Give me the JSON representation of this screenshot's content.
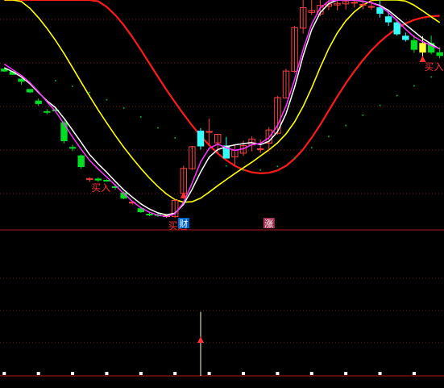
{
  "chart_data": {
    "type": "candlestick",
    "bar_count": 52,
    "colors": {
      "background": "#000000",
      "grid": "#7a1a1a",
      "up": "#33ffff",
      "down": "#00dd22",
      "up_outline": "#ff4040",
      "ma_white": "#ffffff",
      "ma_magenta": "#ff33ff",
      "ma_yellow": "#ffff00",
      "ma_red": "#ff1a1a",
      "dots": "#00aa44",
      "signal": "#ff3333",
      "highlight": "#ffff33",
      "volume_dots": "#ffffff"
    },
    "candles": [
      {
        "o": 0.33,
        "h": 0.33,
        "l": 0.22,
        "c": 0.25,
        "color": "down"
      },
      {
        "o": 0.22,
        "h": 0.25,
        "l": 0.09,
        "c": 0.12,
        "color": "down"
      },
      {
        "o": -0.15,
        "h": -0.04,
        "l": -0.27,
        "c": -0.06,
        "color": "down"
      },
      {
        "o": -0.46,
        "h": -0.47,
        "l": -0.6,
        "c": -0.56,
        "color": "down"
      },
      {
        "o": -0.91,
        "h": -0.81,
        "l": -1.1,
        "c": -1.01,
        "color": "down"
      },
      {
        "o": -1.32,
        "h": -1.22,
        "l": -1.43,
        "c": -1.33,
        "color": "down"
      },
      {
        "o": -1.27,
        "h": -1.17,
        "l": -1.32,
        "c": -1.26,
        "color": "down"
      },
      {
        "o": -1.75,
        "h": -1.67,
        "l": -2.55,
        "c": -2.45,
        "color": "down"
      },
      {
        "o": -2.71,
        "h": -2.6,
        "l": -2.85,
        "c": -2.74,
        "color": "down"
      },
      {
        "o": -3.03,
        "h": -2.98,
        "l": -3.54,
        "c": -3.45,
        "color": "down"
      },
      {
        "o": -3.91,
        "h": -3.86,
        "l": -4.04,
        "c": -3.95,
        "color": "up_outline"
      },
      {
        "o": -3.97,
        "h": -3.86,
        "l": -4.04,
        "c": -3.93,
        "color": "down"
      },
      {
        "o": -3.98,
        "h": -3.94,
        "l": -4.03,
        "c": -4.0,
        "color": "down"
      },
      {
        "o": -4.23,
        "h": -4.12,
        "l": -4.34,
        "c": -4.23,
        "color": "down"
      },
      {
        "o": -4.47,
        "h": -4.42,
        "l": -4.71,
        "c": -4.67,
        "color": "down"
      },
      {
        "o": -4.83,
        "h": -4.78,
        "l": -4.92,
        "c": -4.83,
        "color": "up_outline"
      },
      {
        "o": -5.08,
        "h": -5.02,
        "l": -5.24,
        "c": -5.2,
        "color": "down"
      },
      {
        "o": -5.29,
        "h": -5.24,
        "l": -5.37,
        "c": -5.29,
        "color": "down"
      },
      {
        "o": -5.31,
        "h": -5.26,
        "l": -5.4,
        "c": -5.32,
        "color": "down"
      },
      {
        "o": -5.35,
        "h": -5.32,
        "l": -5.43,
        "c": -5.38,
        "color": "highlight"
      },
      {
        "o": -5.38,
        "h": -4.69,
        "l": -5.43,
        "c": -4.76,
        "color": "up_outline"
      },
      {
        "o": -4.49,
        "h": -3.42,
        "l": -4.54,
        "c": -3.52,
        "color": "up_outline"
      },
      {
        "o": -3.53,
        "h": -2.65,
        "l": -3.58,
        "c": -2.68,
        "color": "up_outline"
      },
      {
        "o": -2.65,
        "h": -1.96,
        "l": -2.79,
        "c": -2.07,
        "color": "up"
      },
      {
        "o": -2.09,
        "h": -1.6,
        "l": -2.63,
        "c": -2.11,
        "color": "up_outline"
      },
      {
        "o": -2.2,
        "h": -2.18,
        "l": -2.92,
        "c": -2.53,
        "color": "up_outline"
      },
      {
        "o": -2.65,
        "h": -2.3,
        "l": -3.03,
        "c": -3.12,
        "color": "up"
      },
      {
        "o": -3.07,
        "h": -2.61,
        "l": -3.42,
        "c": -2.82,
        "color": "up_outline"
      },
      {
        "o": -2.93,
        "h": -2.45,
        "l": -3.03,
        "c": -2.64,
        "color": "up_outline"
      },
      {
        "o": -2.61,
        "h": -2.28,
        "l": -2.86,
        "c": -2.38,
        "color": "up_outline"
      },
      {
        "o": -2.76,
        "h": -2.4,
        "l": -2.92,
        "c": -2.76,
        "color": "up_outline"
      },
      {
        "o": -2.54,
        "h": -1.92,
        "l": -2.86,
        "c": -2.03,
        "color": "up_outline"
      },
      {
        "o": -2.16,
        "h": -0.71,
        "l": -2.21,
        "c": -0.78,
        "color": "up_outline"
      },
      {
        "o": -0.79,
        "h": 0.34,
        "l": -0.8,
        "c": 0.25,
        "color": "up_outline"
      },
      {
        "o": 0.24,
        "h": 2.0,
        "l": 0.18,
        "c": 1.93,
        "color": "up_outline"
      },
      {
        "o": 1.91,
        "h": 3.0,
        "l": 1.7,
        "c": 2.7,
        "color": "up_outline"
      },
      {
        "o": 2.59,
        "h": 3.4,
        "l": 2.42,
        "c": 2.52,
        "color": "up_outline"
      },
      {
        "o": 2.46,
        "h": 3.0,
        "l": 2.37,
        "c": 2.79,
        "color": "up_outline"
      },
      {
        "o": 2.76,
        "h": 3.0,
        "l": 2.61,
        "c": 2.84,
        "color": "up_outline"
      },
      {
        "o": 2.81,
        "h": 3.0,
        "l": 2.6,
        "c": 2.87,
        "color": "up_outline"
      },
      {
        "o": 2.85,
        "h": 3.0,
        "l": 2.63,
        "c": 2.94,
        "color": "up_outline"
      },
      {
        "o": 2.91,
        "h": 3.0,
        "l": 2.71,
        "c": 2.89,
        "color": "up_outline"
      },
      {
        "o": 2.83,
        "h": 3.0,
        "l": 2.64,
        "c": 2.81,
        "color": "up_outline"
      },
      {
        "o": 2.75,
        "h": 3.0,
        "l": 2.62,
        "c": 2.73,
        "color": "up_outline"
      },
      {
        "o": 2.7,
        "h": 3.0,
        "l": 2.32,
        "c": 2.48,
        "color": "up"
      },
      {
        "o": 2.35,
        "h": 2.62,
        "l": 2.0,
        "c": 2.15,
        "color": "up"
      },
      {
        "o": 2.12,
        "h": 2.23,
        "l": 1.62,
        "c": 1.69,
        "color": "up"
      },
      {
        "o": 1.6,
        "h": 1.74,
        "l": 1.39,
        "c": 1.47,
        "color": "up"
      },
      {
        "o": 1.43,
        "h": 1.64,
        "l": 0.96,
        "c": 1.09,
        "color": "down"
      },
      {
        "o": 0.98,
        "h": 1.6,
        "l": 0.71,
        "c": 1.32,
        "color": "highlight"
      },
      {
        "o": 1.32,
        "h": 1.62,
        "l": 0.9,
        "c": 0.98,
        "color": "down"
      },
      {
        "o": 0.96,
        "h": 1.18,
        "l": 0.74,
        "c": 0.85,
        "color": "down"
      }
    ],
    "ma_white": [
      0.38,
      0.22,
      0.02,
      -0.24,
      -0.58,
      -0.9,
      -1.17,
      -1.58,
      -2.04,
      -2.51,
      -2.99,
      -3.35,
      -3.67,
      -4.02,
      -4.35,
      -4.63,
      -4.89,
      -5.09,
      -5.24,
      -5.32,
      -5.25,
      -4.91,
      -4.33,
      -3.66,
      -3.08,
      -2.79,
      -2.68,
      -2.61,
      -2.56,
      -2.52,
      -2.6,
      -2.47,
      -2.1,
      -1.4,
      -0.38,
      0.84,
      1.85,
      2.51,
      2.86,
      3.0,
      3.0,
      2.99,
      2.95,
      2.89,
      2.79,
      2.6,
      2.33,
      2.05,
      1.78,
      1.51,
      1.3,
      1.1
    ],
    "ma_magenta": [
      0.52,
      0.3,
      0.08,
      -0.2,
      -0.55,
      -0.94,
      -1.31,
      -1.8,
      -2.31,
      -2.78,
      -3.21,
      -3.55,
      -3.85,
      -4.17,
      -4.49,
      -4.79,
      -5.04,
      -5.22,
      -5.33,
      -5.39,
      -5.28,
      -4.84,
      -4.09,
      -3.27,
      -2.74,
      -2.58,
      -2.72,
      -2.82,
      -2.76,
      -2.6,
      -2.55,
      -2.33,
      -1.86,
      -1.1,
      -0.08,
      1.09,
      2.07,
      2.69,
      2.96,
      3.0,
      3.0,
      3.0,
      2.96,
      2.89,
      2.76,
      2.52,
      2.2,
      1.87,
      1.58,
      1.39,
      1.24,
      1.11
    ],
    "ma_yellow": [
      3.0,
      3.0,
      2.94,
      2.68,
      2.32,
      1.9,
      1.44,
      0.93,
      0.38,
      -0.18,
      -0.73,
      -1.26,
      -1.76,
      -2.24,
      -2.7,
      -3.12,
      -3.52,
      -3.89,
      -4.22,
      -4.51,
      -4.73,
      -4.83,
      -4.81,
      -4.67,
      -4.44,
      -4.19,
      -3.95,
      -3.72,
      -3.5,
      -3.28,
      -3.04,
      -2.8,
      -2.53,
      -2.18,
      -1.72,
      -1.12,
      -0.4,
      0.39,
      1.12,
      1.72,
      2.19,
      2.54,
      2.8,
      2.98,
      3.0,
      3.0,
      3.0,
      2.96,
      2.8,
      2.58,
      2.35,
      2.13
    ],
    "ma_red": [
      3.0,
      3.0,
      3.0,
      3.0,
      3.0,
      3.0,
      3.0,
      3.0,
      3.0,
      3.0,
      3.0,
      2.95,
      2.73,
      2.42,
      2.03,
      1.57,
      1.07,
      0.55,
      0.03,
      -0.48,
      -0.96,
      -1.42,
      -1.86,
      -2.26,
      -2.62,
      -2.94,
      -3.2,
      -3.42,
      -3.57,
      -3.67,
      -3.71,
      -3.69,
      -3.6,
      -3.42,
      -3.14,
      -2.78,
      -2.33,
      -1.83,
      -1.28,
      -0.74,
      -0.23,
      0.24,
      0.67,
      1.05,
      1.38,
      1.66,
      1.9,
      2.09,
      2.23,
      2.32,
      2.37,
      2.39
    ],
    "dots": [
      {
        "x": 6,
        "y": -0.12
      },
      {
        "x": 8,
        "y": -0.34
      },
      {
        "x": 10,
        "y": -0.58
      },
      {
        "x": 12,
        "y": -0.86
      },
      {
        "x": 14,
        "y": -1.18
      },
      {
        "x": 16,
        "y": -1.53
      },
      {
        "x": 18,
        "y": -1.95
      },
      {
        "x": 20,
        "y": -2.34
      },
      {
        "x": 22,
        "y": -2.76
      },
      {
        "x": 24,
        "y": -3.12
      },
      {
        "x": 26,
        "y": -3.42
      },
      {
        "x": 28,
        "y": -3.58
      },
      {
        "x": 30,
        "y": -3.58
      },
      {
        "x": 32,
        "y": -3.44
      },
      {
        "x": 34,
        "y": -3.12
      },
      {
        "x": 36,
        "y": -2.72
      },
      {
        "x": 38,
        "y": -2.28
      },
      {
        "x": 40,
        "y": -1.86
      },
      {
        "x": 42,
        "y": -1.46
      },
      {
        "x": 44,
        "y": -1.08
      },
      {
        "x": 46,
        "y": -0.7
      },
      {
        "x": 48,
        "y": -0.32
      },
      {
        "x": 50,
        "y": 0.02
      }
    ],
    "signals": [
      {
        "x": 10,
        "y": -3.96,
        "label": "买入",
        "arrow": false
      },
      {
        "x": 19,
        "y": -5.43,
        "label": "买进",
        "arrow": false
      },
      {
        "x": 21,
        "y": -4.55,
        "label": "",
        "arrow": true
      },
      {
        "x": 49,
        "y": 0.72,
        "label": "买入",
        "arrow": true
      }
    ],
    "markers": [
      {
        "x": 21,
        "label": "财",
        "bg": "#0066cc"
      },
      {
        "x": 31,
        "label": "涨",
        "bg": "#aa3355"
      }
    ],
    "volume_spike": {
      "x": 23,
      "value": 0.98
    },
    "volume_dots_every": 4,
    "ylim": [
      -5.9,
      3.0
    ]
  }
}
